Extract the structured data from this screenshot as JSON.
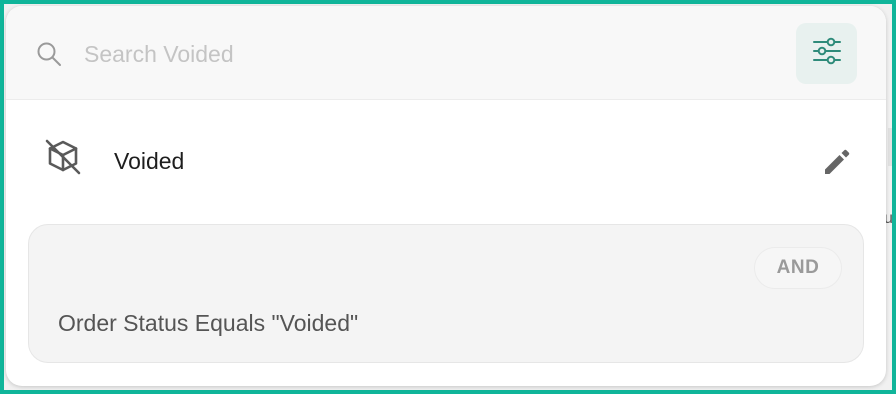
{
  "search": {
    "placeholder": "Search Voided",
    "value": "",
    "icon": "search-icon"
  },
  "filter_button": {
    "icon": "sliders-icon"
  },
  "item": {
    "icon": "box-off-icon",
    "label": "Voided",
    "edit_icon": "pencil-icon"
  },
  "condition": {
    "operator_label": "AND",
    "text": "Order Status Equals \"Voided\""
  },
  "backdrop": {
    "partial_glyph": "u"
  },
  "colors": {
    "frame": "#10b59a",
    "accent": "#2e8b7a",
    "filter_button_bg": "#e8f1ef",
    "card_bg": "#f4f4f4"
  }
}
